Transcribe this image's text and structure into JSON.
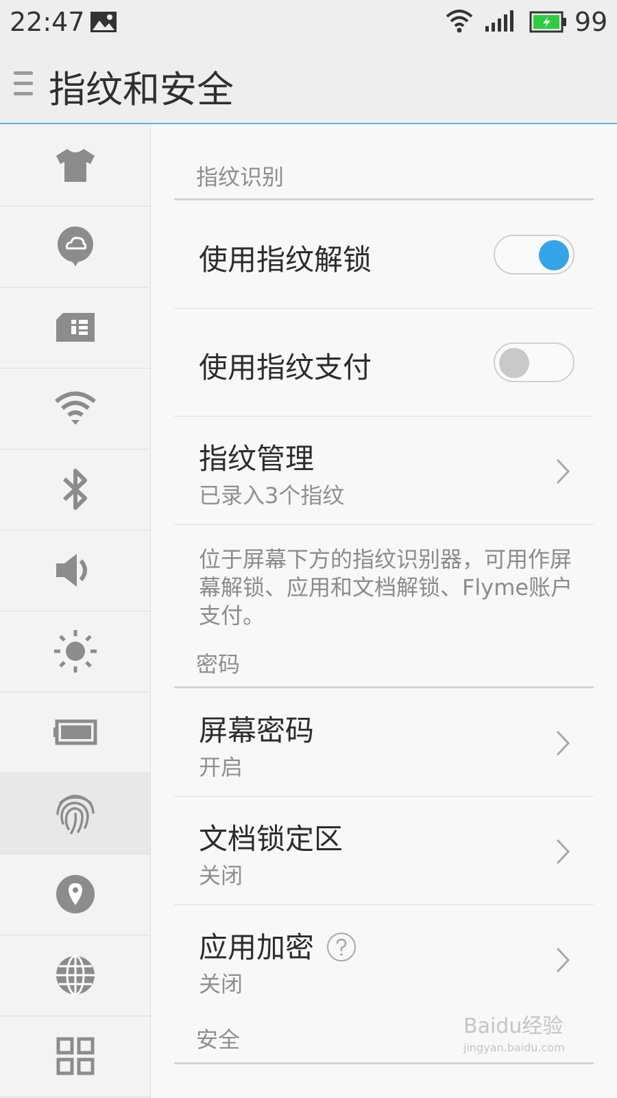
{
  "status_bar": {
    "time": "22:47",
    "battery_percent": "99",
    "battery_color": "#2ecc40",
    "icons": [
      "image-icon",
      "wifi-icon",
      "signal-icon",
      "battery-charging-icon"
    ]
  },
  "header": {
    "title": "指纹和安全",
    "menu_icon": "hamburger-menu-icon"
  },
  "sidebar": {
    "items": [
      {
        "icon": "theme-shirt-icon",
        "active": false
      },
      {
        "icon": "cloud-account-icon",
        "active": false
      },
      {
        "icon": "sim-card-icon",
        "active": false
      },
      {
        "icon": "wifi-icon",
        "active": false
      },
      {
        "icon": "bluetooth-icon",
        "active": false
      },
      {
        "icon": "sound-icon",
        "active": false
      },
      {
        "icon": "brightness-icon",
        "active": false
      },
      {
        "icon": "battery-icon",
        "active": false
      },
      {
        "icon": "fingerprint-icon",
        "active": true
      },
      {
        "icon": "location-icon",
        "active": false
      },
      {
        "icon": "globe-icon",
        "active": false
      },
      {
        "icon": "apps-grid-icon",
        "active": false
      }
    ]
  },
  "sections": {
    "fingerprint": {
      "header": "指纹识别",
      "unlock": {
        "label": "使用指纹解锁",
        "enabled": true
      },
      "payment": {
        "label": "使用指纹支付",
        "enabled": false
      },
      "management": {
        "label": "指纹管理",
        "sub": "已录入3个指纹"
      },
      "description": "位于屏幕下方的指纹识别器，可用作屏幕解锁、应用和文档解锁、Flyme账户支付。"
    },
    "password": {
      "header": "密码",
      "screen_password": {
        "label": "屏幕密码",
        "sub": "开启"
      },
      "doc_lock": {
        "label": "文档锁定区",
        "sub": "关闭"
      },
      "app_encrypt": {
        "label": "应用加密",
        "sub": "关闭"
      }
    },
    "security": {
      "header": "安全"
    }
  },
  "accent_color": "#35a3e8",
  "watermark": {
    "text": "Baidu经验",
    "sub": "jingyan.baidu.com"
  }
}
